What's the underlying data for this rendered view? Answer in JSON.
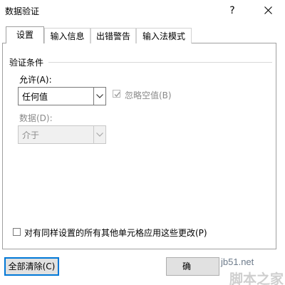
{
  "window": {
    "title": "数据验证",
    "help_glyph": "?"
  },
  "tabs": [
    {
      "label": "设置",
      "active": true
    },
    {
      "label": "输入信息",
      "active": false
    },
    {
      "label": "出错警告",
      "active": false
    },
    {
      "label": "输入法模式",
      "active": false
    }
  ],
  "settings": {
    "group_label": "验证条件",
    "allow_label": "允许(A):",
    "allow_value": "任何值",
    "ignore_blank_label": "忽略空值(B)",
    "ignore_blank_checked": true,
    "data_label": "数据(D):",
    "data_value": "介于",
    "apply_all_label": "对有同样设置的所有其他单元格应用这些更改(P)",
    "apply_all_checked": false
  },
  "buttons": {
    "clear_all": "全部清除(C)",
    "ok_partial": "确"
  },
  "watermark": {
    "url": "jb51.net",
    "name": "脚本之家"
  },
  "colors": {
    "focus": "#0078d7",
    "disabled_text": "#8a8a8a"
  }
}
